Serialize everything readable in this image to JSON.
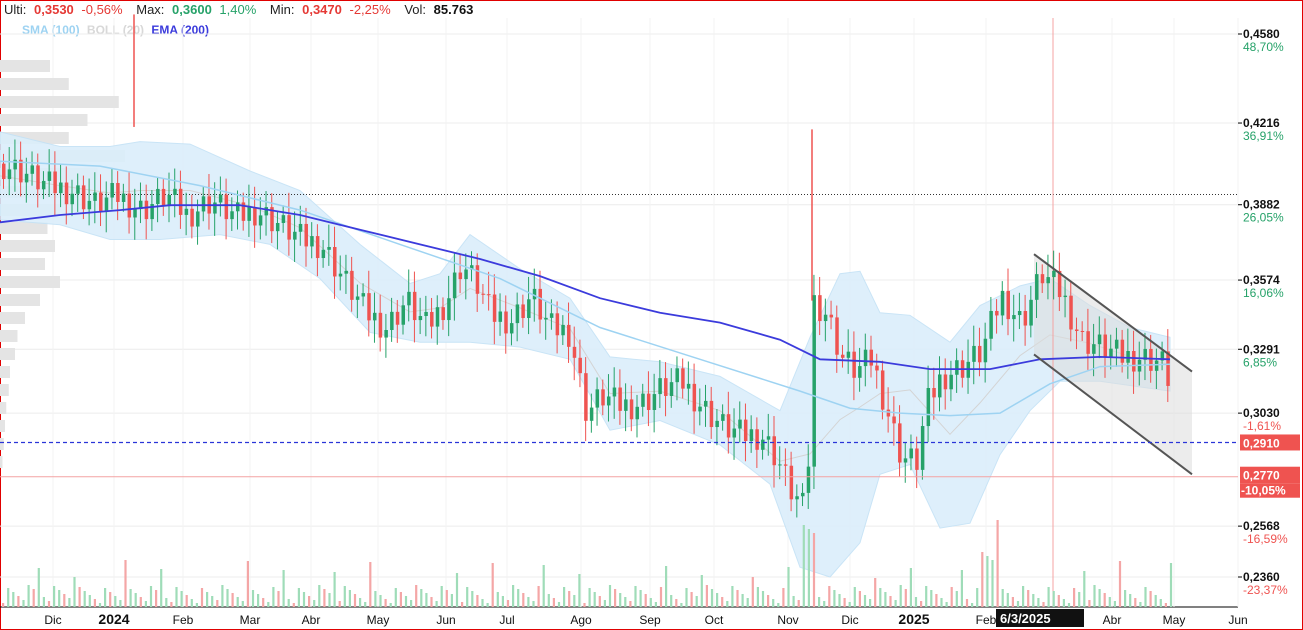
{
  "header": {
    "last_label": "Ulti:",
    "last_value": "0,3530",
    "last_change": "-0,56%",
    "max_label": "Max:",
    "max_value": "0,3600",
    "max_change": "1,40%",
    "min_label": "Min:",
    "min_value": "0,3470",
    "min_change": "-2,25%",
    "vol_label": "Vol:",
    "vol_value": "85.763"
  },
  "legend": {
    "sma": "SMA (100)",
    "boll": "BOLL (20)",
    "ema": "EMA (200)",
    "sma_color": "#9ed3f2",
    "boll_color": "#d8d8d8",
    "ema_color": "#3b3bdc"
  },
  "colors": {
    "up": "#26a269",
    "down": "#ef5350",
    "band_fill": "#dbeefb",
    "last_price_bg": "#ef5350",
    "frame": "#e00000"
  },
  "chart_data": {
    "type": "candlestick",
    "ylim": [
      0.23,
      0.47
    ],
    "y_ticks": [
      {
        "price": 0.458,
        "label": "0,4580",
        "pct": "48,70%"
      },
      {
        "price": 0.4216,
        "label": "0,4216",
        "pct": "36,91%"
      },
      {
        "price": 0.3882,
        "label": "0,3882",
        "pct": "26,05%"
      },
      {
        "price": 0.3574,
        "label": "0,3574",
        "pct": "16,06%"
      },
      {
        "price": 0.3291,
        "label": "0,3291",
        "pct": "6,85%"
      },
      {
        "price": 0.303,
        "label": "0,3030",
        "pct": "-1,61%"
      },
      {
        "price": 0.2568,
        "label": "0,2568",
        "pct": "-16,59%"
      },
      {
        "price": 0.236,
        "label": "0,2360",
        "pct": "-23,37%"
      }
    ],
    "price_markers": [
      {
        "price": 0.291,
        "label": "0,2910",
        "kind": "filled"
      },
      {
        "price": 0.277,
        "label": "0,2770",
        "pct": "-10,05%",
        "kind": "filled"
      }
    ],
    "reference_line": 0.3924,
    "x_labels": [
      {
        "label": "Dic",
        "bold": false
      },
      {
        "label": "2024",
        "bold": true
      },
      {
        "label": "Feb",
        "bold": false
      },
      {
        "label": "Mar",
        "bold": false
      },
      {
        "label": "Abr",
        "bold": false
      },
      {
        "label": "May",
        "bold": false
      },
      {
        "label": "Jun",
        "bold": false
      },
      {
        "label": "Jul",
        "bold": false
      },
      {
        "label": "Ago",
        "bold": false
      },
      {
        "label": "Sep",
        "bold": false
      },
      {
        "label": "Oct",
        "bold": false
      },
      {
        "label": "Nov",
        "bold": false
      },
      {
        "label": "Dic",
        "bold": false
      },
      {
        "label": "2025",
        "bold": true
      },
      {
        "label": "Feb",
        "bold": false
      },
      {
        "label": "Abr",
        "bold": false
      },
      {
        "label": "May",
        "bold": false
      },
      {
        "label": "Jun",
        "bold": false
      }
    ],
    "cursor_date_label": "6/3/2025",
    "price_path": [
      [
        0,
        0.405
      ],
      [
        20,
        0.402
      ],
      [
        45,
        0.396
      ],
      [
        70,
        0.394
      ],
      [
        95,
        0.388
      ],
      [
        115,
        0.392
      ],
      [
        140,
        0.386
      ],
      [
        165,
        0.392
      ],
      [
        185,
        0.384
      ],
      [
        210,
        0.39
      ],
      [
        235,
        0.383
      ],
      [
        255,
        0.386
      ],
      [
        275,
        0.381
      ],
      [
        300,
        0.374
      ],
      [
        320,
        0.372
      ],
      [
        345,
        0.356
      ],
      [
        365,
        0.344
      ],
      [
        385,
        0.338
      ],
      [
        405,
        0.349
      ],
      [
        425,
        0.338
      ],
      [
        445,
        0.349
      ],
      [
        460,
        0.364
      ],
      [
        475,
        0.356
      ],
      [
        490,
        0.343
      ],
      [
        510,
        0.341
      ],
      [
        530,
        0.351
      ],
      [
        548,
        0.338
      ],
      [
        568,
        0.336
      ],
      [
        585,
        0.303
      ],
      [
        600,
        0.31
      ],
      [
        620,
        0.306
      ],
      [
        640,
        0.307
      ],
      [
        660,
        0.313
      ],
      [
        680,
        0.316
      ],
      [
        700,
        0.306
      ],
      [
        720,
        0.298
      ],
      [
        740,
        0.294
      ],
      [
        760,
        0.294
      ],
      [
        775,
        0.285
      ],
      [
        790,
        0.271
      ],
      [
        805,
        0.262
      ],
      [
        812,
        0.349
      ],
      [
        825,
        0.344
      ],
      [
        840,
        0.326
      ],
      [
        855,
        0.32
      ],
      [
        870,
        0.325
      ],
      [
        885,
        0.305
      ],
      [
        900,
        0.285
      ],
      [
        915,
        0.283
      ],
      [
        925,
        0.306
      ],
      [
        940,
        0.318
      ],
      [
        960,
        0.322
      ],
      [
        980,
        0.328
      ],
      [
        1000,
        0.351
      ],
      [
        1020,
        0.34
      ],
      [
        1040,
        0.36
      ],
      [
        1060,
        0.352
      ],
      [
        1080,
        0.333
      ],
      [
        1100,
        0.33
      ],
      [
        1120,
        0.326
      ],
      [
        1140,
        0.326
      ],
      [
        1160,
        0.324
      ],
      [
        1168,
        0.316
      ],
      [
        1172,
        0.296
      ]
    ],
    "sma_100": [
      [
        0,
        0.406
      ],
      [
        100,
        0.404
      ],
      [
        200,
        0.396
      ],
      [
        300,
        0.386
      ],
      [
        400,
        0.372
      ],
      [
        500,
        0.358
      ],
      [
        600,
        0.338
      ],
      [
        700,
        0.325
      ],
      [
        800,
        0.312
      ],
      [
        850,
        0.305
      ],
      [
        900,
        0.303
      ],
      [
        950,
        0.302
      ],
      [
        1000,
        0.303
      ],
      [
        1050,
        0.315
      ],
      [
        1100,
        0.322
      ],
      [
        1170,
        0.323
      ]
    ],
    "ema_200": [
      [
        0,
        0.381
      ],
      [
        60,
        0.384
      ],
      [
        120,
        0.386
      ],
      [
        170,
        0.388
      ],
      [
        240,
        0.388
      ],
      [
        300,
        0.384
      ],
      [
        360,
        0.378
      ],
      [
        420,
        0.372
      ],
      [
        480,
        0.366
      ],
      [
        540,
        0.359
      ],
      [
        600,
        0.35
      ],
      [
        660,
        0.344
      ],
      [
        720,
        0.34
      ],
      [
        780,
        0.333
      ],
      [
        820,
        0.325
      ],
      [
        880,
        0.324
      ],
      [
        930,
        0.321
      ],
      [
        990,
        0.321
      ],
      [
        1040,
        0.325
      ],
      [
        1100,
        0.326
      ],
      [
        1170,
        0.325
      ]
    ],
    "boll_upper": [
      [
        0,
        0.418
      ],
      [
        60,
        0.412
      ],
      [
        110,
        0.412
      ],
      [
        140,
        0.414
      ],
      [
        190,
        0.413
      ],
      [
        250,
        0.402
      ],
      [
        300,
        0.394
      ],
      [
        360,
        0.372
      ],
      [
        410,
        0.356
      ],
      [
        440,
        0.36
      ],
      [
        470,
        0.376
      ],
      [
        520,
        0.362
      ],
      [
        570,
        0.35
      ],
      [
        610,
        0.326
      ],
      [
        660,
        0.324
      ],
      [
        720,
        0.318
      ],
      [
        780,
        0.304
      ],
      [
        810,
        0.334
      ],
      [
        840,
        0.36
      ],
      [
        860,
        0.361
      ],
      [
        880,
        0.344
      ],
      [
        910,
        0.343
      ],
      [
        950,
        0.332
      ],
      [
        980,
        0.347
      ],
      [
        1020,
        0.355
      ],
      [
        1050,
        0.358
      ],
      [
        1090,
        0.347
      ],
      [
        1130,
        0.338
      ],
      [
        1170,
        0.334
      ]
    ],
    "boll_lower": [
      [
        0,
        0.382
      ],
      [
        60,
        0.38
      ],
      [
        110,
        0.374
      ],
      [
        160,
        0.374
      ],
      [
        220,
        0.376
      ],
      [
        270,
        0.372
      ],
      [
        320,
        0.358
      ],
      [
        370,
        0.336
      ],
      [
        420,
        0.332
      ],
      [
        470,
        0.332
      ],
      [
        520,
        0.33
      ],
      [
        570,
        0.325
      ],
      [
        610,
        0.296
      ],
      [
        660,
        0.3
      ],
      [
        720,
        0.29
      ],
      [
        770,
        0.274
      ],
      [
        800,
        0.24
      ],
      [
        830,
        0.236
      ],
      [
        860,
        0.25
      ],
      [
        880,
        0.278
      ],
      [
        910,
        0.282
      ],
      [
        940,
        0.256
      ],
      [
        970,
        0.258
      ],
      [
        1000,
        0.286
      ],
      [
        1030,
        0.304
      ],
      [
        1060,
        0.316
      ],
      [
        1100,
        0.316
      ],
      [
        1170,
        0.312
      ]
    ],
    "channel_upper": [
      [
        1034,
        0.368
      ],
      [
        1192,
        0.32
      ]
    ],
    "channel_lower": [
      [
        1034,
        0.327
      ],
      [
        1192,
        0.278
      ]
    ],
    "volume_profile": [
      0.4,
      0.55,
      0.95,
      0.7,
      0.55,
      1.0,
      0.78,
      0.62,
      0.48,
      0.38,
      0.44,
      0.36,
      0.48,
      0.32,
      0.2,
      0.14,
      0.12,
      0.08,
      0.07,
      0.05,
      0.04,
      0.03,
      0.02
    ]
  }
}
